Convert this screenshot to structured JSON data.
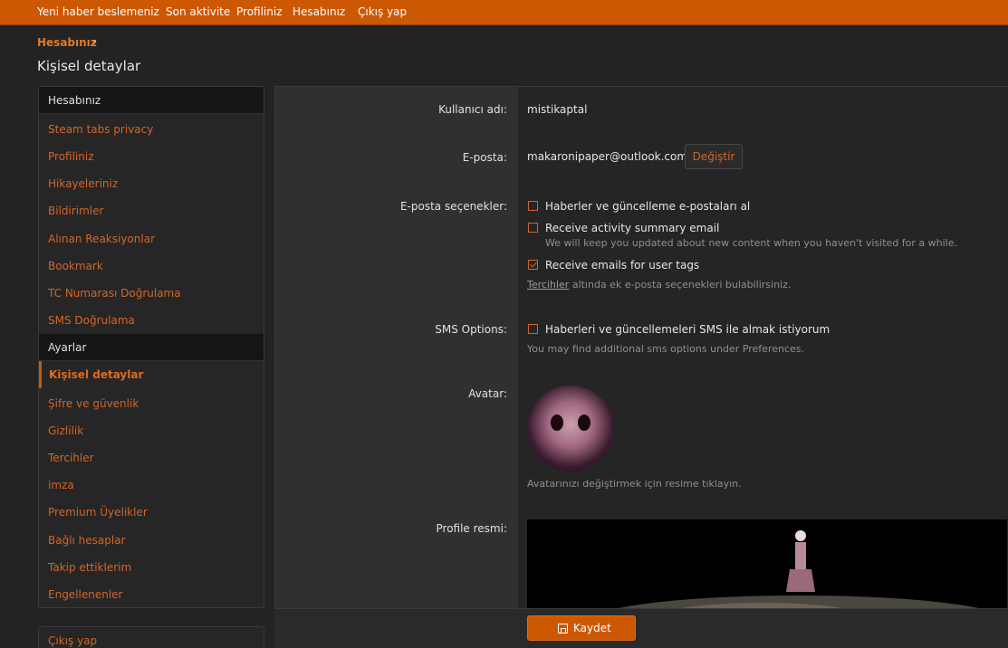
{
  "topnav": [
    "Yeni haber beslemeniz",
    "Son aktivite",
    "Profiliniz",
    "Hesabınız",
    "Çıkış yap"
  ],
  "breadcrumb": "Hesabınız",
  "page_title": "Kişisel detaylar",
  "sidebar": {
    "section1_title": "Hesabınız",
    "section1_items": [
      "Steam tabs privacy",
      "Profiliniz",
      "Hikayeleriniz",
      "Bildirimler",
      "Alınan Reaksiyonlar",
      "Bookmark",
      "TC Numarası Doğrulama",
      "SMS Doğrulama"
    ],
    "section2_title": "Ayarlar",
    "active_item": "Kişisel detaylar",
    "section2_items": [
      "Şifre ve güvenlik",
      "Gizlilik",
      "Tercihler",
      "imza",
      "Premium Üyelikler",
      "Bağlı hesaplar",
      "Takip ettiklerim",
      "Engellenenler"
    ],
    "logout": "Çıkış yap"
  },
  "form": {
    "username_label": "Kullanıcı adı:",
    "username_value": "mistikaptal",
    "email_label": "E-posta:",
    "email_value": "makaronipaper@outlook.com",
    "change_button": "Değiştir",
    "email_options_label": "E-posta seçenekler:",
    "opt1": "Haberler ve güncelleme e-postaları al",
    "opt2": "Receive activity summary email",
    "opt2_hint": "We will keep you updated about new content when you haven't visited for a while.",
    "opt3": "Receive emails for user tags",
    "prefs_link": "Tercihler",
    "prefs_hint": " altında ek e-posta seçenekleri bulabilirsiniz.",
    "sms_label": "SMS Options:",
    "sms_opt": "Haberleri ve güncellemeleri SMS ile almak istiyorum",
    "sms_hint": "You may find additional sms options under Preferences.",
    "avatar_label": "Avatar:",
    "avatar_hint": "Avatarınızı değiştirmek için resime tıklayın.",
    "profile_image_label": "Profile resmi:",
    "save_button": "Kaydet"
  },
  "checkbox_states": {
    "opt1": false,
    "opt2": false,
    "opt3": true,
    "sms": false
  },
  "colors": {
    "accent": "#cc5803",
    "link": "#d2652a",
    "background": "#232323"
  }
}
